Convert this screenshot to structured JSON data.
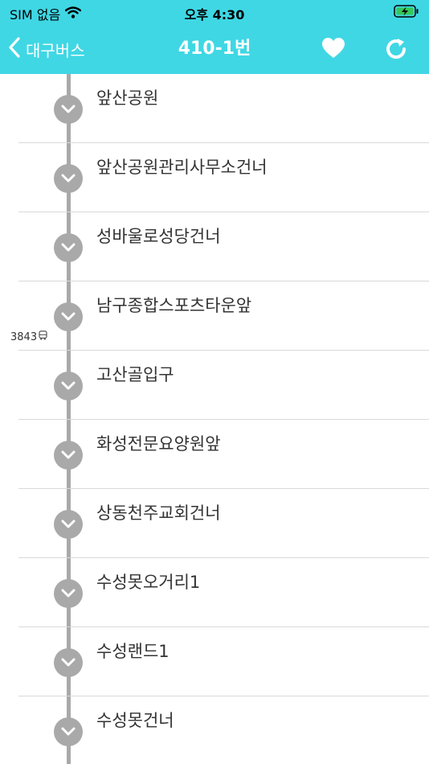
{
  "status_bar": {
    "carrier": "SIM 없음",
    "time": "오후 4:30"
  },
  "nav": {
    "back_label": "대구버스",
    "title": "410-1번"
  },
  "bus_marker": {
    "number": "3843"
  },
  "stops": [
    {
      "name": "앞산공원"
    },
    {
      "name": "앞산공원관리사무소건너"
    },
    {
      "name": "성바울로성당건너"
    },
    {
      "name": "남구종합스포츠타운앞"
    },
    {
      "name": "고산골입구"
    },
    {
      "name": "화성전문요양원앞"
    },
    {
      "name": "상동천주교회건너"
    },
    {
      "name": "수성못오거리1"
    },
    {
      "name": "수성랜드1"
    },
    {
      "name": "수성못건너"
    }
  ],
  "colors": {
    "header": "#3fd7e4",
    "route_line": "#a9a9a9"
  }
}
